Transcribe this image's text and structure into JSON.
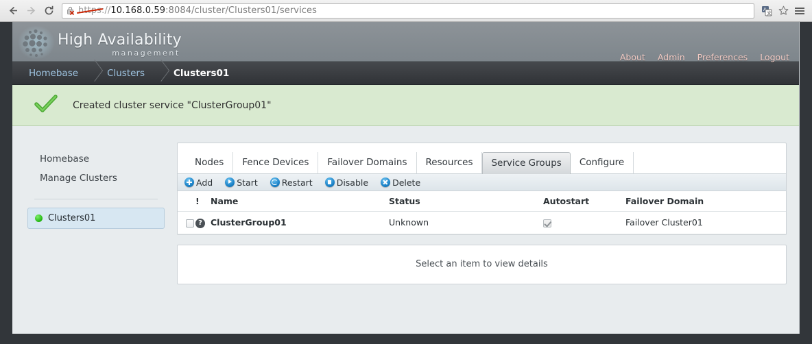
{
  "browser": {
    "back_icon": "back-arrow-icon",
    "forward_icon": "forward-arrow-icon",
    "reload_icon": "reload-icon",
    "security": {
      "icon": "insecure-lock-icon",
      "scheme": "https",
      "separator": "://"
    },
    "url": {
      "host": "10.168.0.59",
      "port": ":8084",
      "path": "/cluster/Clusters01/services",
      "full": "https://10.168.0.59:8084/cluster/Clusters01/services"
    },
    "toolbar_icons": [
      "translate-icon",
      "bookmark-star-icon",
      "menu-hamburger-icon"
    ]
  },
  "header": {
    "title": "High Availability",
    "subtitle": "management",
    "logo_icon": "dot-cluster-logo-icon",
    "nav": [
      {
        "label": "About"
      },
      {
        "label": "Admin"
      },
      {
        "label": "Preferences"
      },
      {
        "label": "Logout"
      }
    ]
  },
  "breadcrumb": [
    {
      "label": "Homebase",
      "current": false
    },
    {
      "label": "Clusters",
      "current": false
    },
    {
      "label": "Clusters01",
      "current": true
    }
  ],
  "alert": {
    "icon": "green-check-icon",
    "message": "Created cluster service \"ClusterGroup01\"",
    "background": "#d9ead0"
  },
  "sidebar": {
    "links": [
      {
        "label": "Homebase"
      },
      {
        "label": "Manage Clusters"
      }
    ],
    "clusters": [
      {
        "label": "Clusters01",
        "status_color": "#22b411",
        "selected": true
      }
    ]
  },
  "tabs": [
    {
      "label": "Nodes",
      "active": false
    },
    {
      "label": "Fence Devices",
      "active": false
    },
    {
      "label": "Failover Domains",
      "active": false
    },
    {
      "label": "Resources",
      "active": false
    },
    {
      "label": "Service Groups",
      "active": true
    },
    {
      "label": "Configure",
      "active": false
    }
  ],
  "toolbar": {
    "buttons": [
      {
        "label": "Add",
        "icon": "plus-circle-icon"
      },
      {
        "label": "Start",
        "icon": "play-circle-icon"
      },
      {
        "label": "Restart",
        "icon": "restart-circle-icon"
      },
      {
        "label": "Disable",
        "icon": "stop-circle-icon"
      },
      {
        "label": "Delete",
        "icon": "close-circle-icon"
      }
    ]
  },
  "table": {
    "headers": {
      "select": "",
      "bang": "!",
      "name": "Name",
      "status": "Status",
      "autostart": "Autostart",
      "failover_domain": "Failover Domain"
    },
    "rows": [
      {
        "selected": false,
        "state_icon": "question-mark-icon",
        "name": "ClusterGroup01",
        "status": "Unknown",
        "autostart": true,
        "autostart_disabled": true,
        "failover_domain": "Failover Cluster01"
      }
    ]
  },
  "details": {
    "placeholder": "Select an item to view details"
  }
}
